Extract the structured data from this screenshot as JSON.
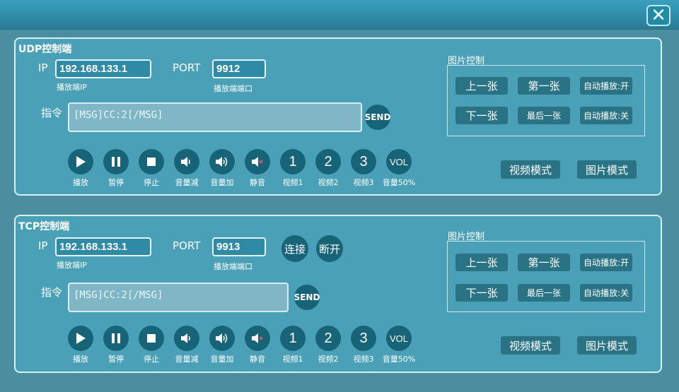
{
  "titlebar": {
    "close_icon": "close-icon"
  },
  "udp": {
    "title": "UDP控制端",
    "ip_label": "IP",
    "ip_value": "192.168.133.1",
    "ip_sub": "播放端IP",
    "port_label": "PORT",
    "port_value": "9912",
    "port_sub": "播放端端口",
    "cmd_label": "指令",
    "cmd_value": "[MSG]CC:2[/MSG]",
    "send": "SEND"
  },
  "tcp": {
    "title": "TCP控制端",
    "ip_label": "IP",
    "ip_value": "192.168.133.1",
    "ip_sub": "播放端IP",
    "port_label": "PORT",
    "port_value": "9913",
    "port_sub": "播放端端口",
    "connect": "连接",
    "disconnect": "断开",
    "cmd_label": "指令",
    "cmd_value": "[MSG]CC:2[/MSG]",
    "send": "SEND"
  },
  "controls": {
    "play": "播放",
    "pause": "暂停",
    "stop": "停止",
    "vol_down": "音量减",
    "vol_up": "音量加",
    "mute": "静音",
    "v1_num": "1",
    "v1": "视频1",
    "v2_num": "2",
    "v2": "视频2",
    "v3_num": "3",
    "v3": "视频3",
    "vol_btn": "VOL",
    "vol50": "音量50%"
  },
  "image_control": {
    "title": "图片控制",
    "prev": "上一张",
    "first": "第一张",
    "auto_on": "自动播放:开",
    "next": "下一张",
    "last": "最后一张",
    "auto_off": "自动播放:关"
  },
  "modes": {
    "video": "视频模式",
    "image": "图片模式"
  }
}
